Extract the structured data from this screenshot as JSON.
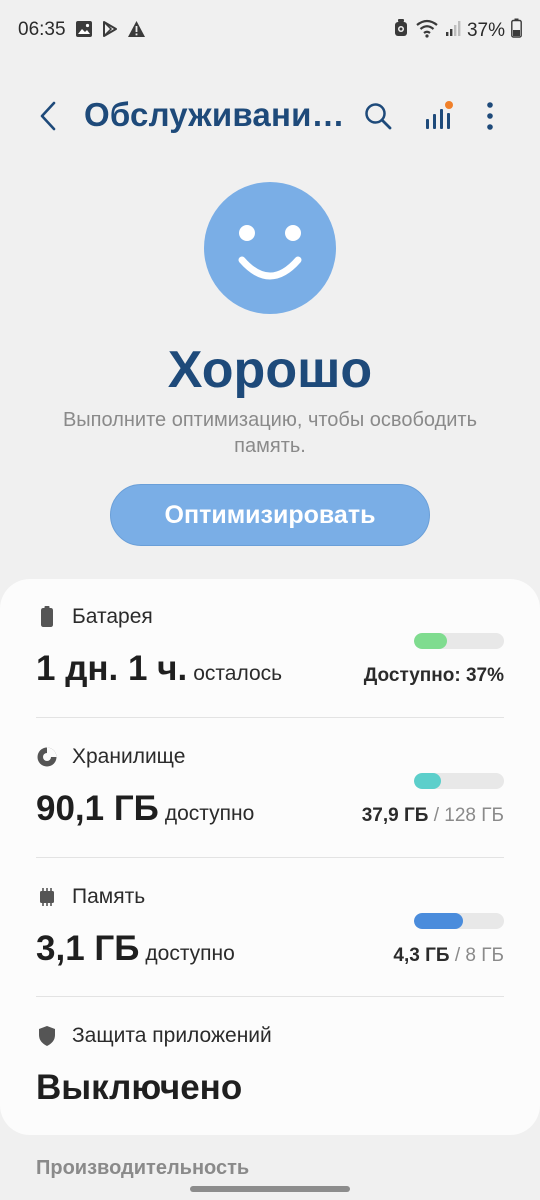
{
  "status_bar": {
    "time": "06:35",
    "battery_percent": "37%",
    "left_icons": [
      "gallery-icon",
      "play-store-icon",
      "warning-icon"
    ],
    "right_icons": [
      "alarm-icon",
      "wifi-icon",
      "signal-icon",
      "battery-icon"
    ]
  },
  "app_bar": {
    "title": "Обслуживани…",
    "icons": [
      "back-arrow-icon",
      "search-icon",
      "stats-icon",
      "more-vert-icon"
    ],
    "notification_dot_color": "#f0802a"
  },
  "hero": {
    "status": "Хорошо",
    "subtitle": "Выполните оптимизацию, чтобы освободить память.",
    "optimize_button": "Оптимизировать",
    "smiley_color": "#7aaee6",
    "title_color": "#1e4a7a"
  },
  "battery": {
    "label": "Батарея",
    "big": "1 дн. 1 ч.",
    "small": "осталось",
    "right_value": "Доступно: 37%",
    "fraction": 0.37,
    "color": "#7fdc8f"
  },
  "storage": {
    "label": "Хранилище",
    "big": "90,1 ГБ",
    "small": "доступно",
    "used": "37,9 ГБ",
    "total": "/ 128 ГБ",
    "fraction": 0.3,
    "color": "#5ccfcb"
  },
  "memory": {
    "label": "Память",
    "big": "3,1 ГБ",
    "small": "доступно",
    "used": "4,3 ГБ",
    "total": "/ 8 ГБ",
    "fraction": 0.54,
    "color": "#4a8cdc"
  },
  "app_protection": {
    "label": "Защита приложений",
    "big": "Выключено"
  },
  "performance_label": "Производительность"
}
